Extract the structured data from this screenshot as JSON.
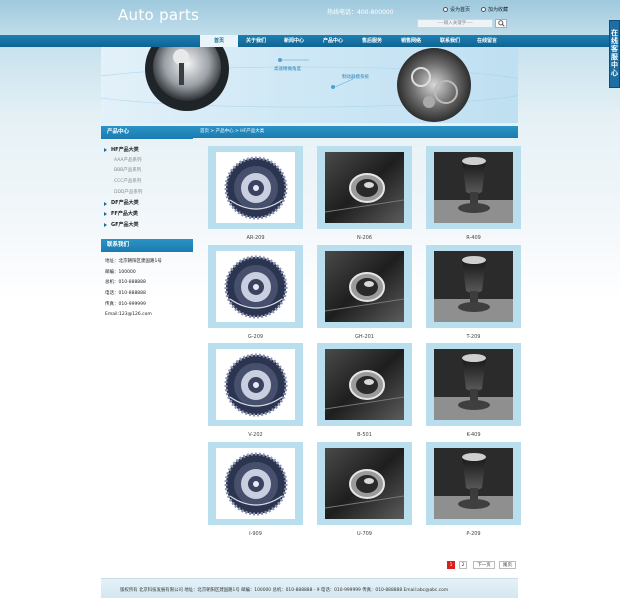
{
  "header": {
    "logo": "Auto parts",
    "hotline": "热线电话：400-800000",
    "links": [
      "设为首页",
      "加为收藏"
    ],
    "search_placeholder": "----输入关键字----"
  },
  "nav": {
    "items": [
      "首页",
      "关于我们",
      "新闻中心",
      "产品中心",
      "售后服务",
      "销售网络",
      "联系我们",
      "在线留言"
    ],
    "active_index": 0
  },
  "banner": {
    "notes": [
      "高速精做角度",
      "制动器模系统"
    ]
  },
  "side_tab": "在线客服中心",
  "sidebar": {
    "products_title": "产品中心",
    "categories": [
      {
        "label": "HF产品大类",
        "type": "cat"
      },
      {
        "label": "AAA产品系列",
        "type": "sub"
      },
      {
        "label": "BBB产品系列",
        "type": "sub"
      },
      {
        "label": "CCC产品系列",
        "type": "sub"
      },
      {
        "label": "DDD产品系列",
        "type": "sub"
      },
      {
        "label": "DF产品大类",
        "type": "cat"
      },
      {
        "label": "FF产品大类",
        "type": "cat"
      },
      {
        "label": "GF产品大类",
        "type": "cat"
      }
    ],
    "contact_title": "联系我们",
    "contact": [
      "地址：北京朝阳区建国路1号",
      "邮编：100000",
      "总机：010-888888",
      "电话：010-888888",
      "传真：010-999999",
      "Email:123@126.com"
    ]
  },
  "breadcrumb": "首页 > 产品中心 > HF产品大类",
  "products": [
    {
      "caption": "AR-209",
      "kind": "gear"
    },
    {
      "caption": "N-206",
      "kind": "knob"
    },
    {
      "caption": "R-409",
      "kind": "shifter"
    },
    {
      "caption": "G-209",
      "kind": "gear"
    },
    {
      "caption": "GH-201",
      "kind": "knob"
    },
    {
      "caption": "T-209",
      "kind": "shifter"
    },
    {
      "caption": "V-202",
      "kind": "gear"
    },
    {
      "caption": "B-501",
      "kind": "knob"
    },
    {
      "caption": "K-409",
      "kind": "shifter"
    },
    {
      "caption": "I-909",
      "kind": "gear"
    },
    {
      "caption": "U-709",
      "kind": "knob"
    },
    {
      "caption": "P-209",
      "kind": "shifter"
    }
  ],
  "pagination": {
    "pages": [
      "1",
      "2"
    ],
    "current": "1",
    "next": "下一页",
    "last": "尾页"
  },
  "footer": {
    "text": "版权所有  北京科技发展有限公司 地址：北京朝阳区建国路1号 邮编：100000  总机：010-888888 - 9 电话：010-999999 传真：010-888888 Email:abc@abc.com"
  }
}
